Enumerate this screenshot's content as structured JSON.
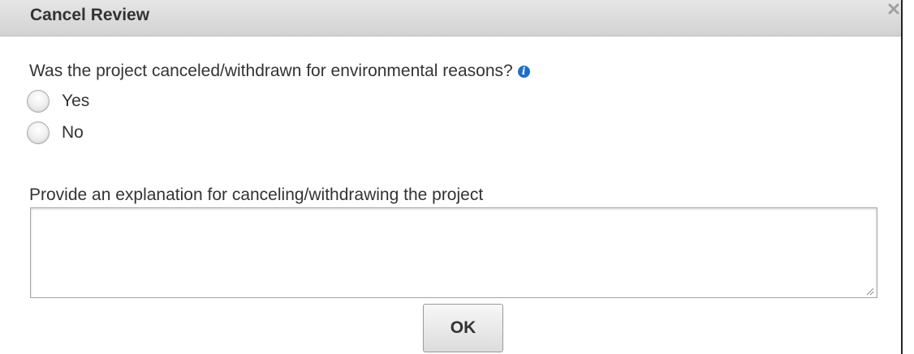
{
  "dialog": {
    "title": "Cancel Review",
    "close_icon": "close-icon"
  },
  "question": {
    "text": "Was the project canceled/withdrawn for environmental reasons?",
    "info_icon": "info-icon",
    "info_glyph": "i",
    "options": [
      {
        "label": "Yes",
        "selected": false
      },
      {
        "label": "No",
        "selected": false
      }
    ]
  },
  "explanation": {
    "label": "Provide an explanation for canceling/withdrawing the project",
    "value": "",
    "placeholder": ""
  },
  "actions": {
    "ok_label": "OK"
  },
  "colors": {
    "accent": "#1f6fc5",
    "titlebar": "#d9d9d9",
    "text": "#333333"
  }
}
